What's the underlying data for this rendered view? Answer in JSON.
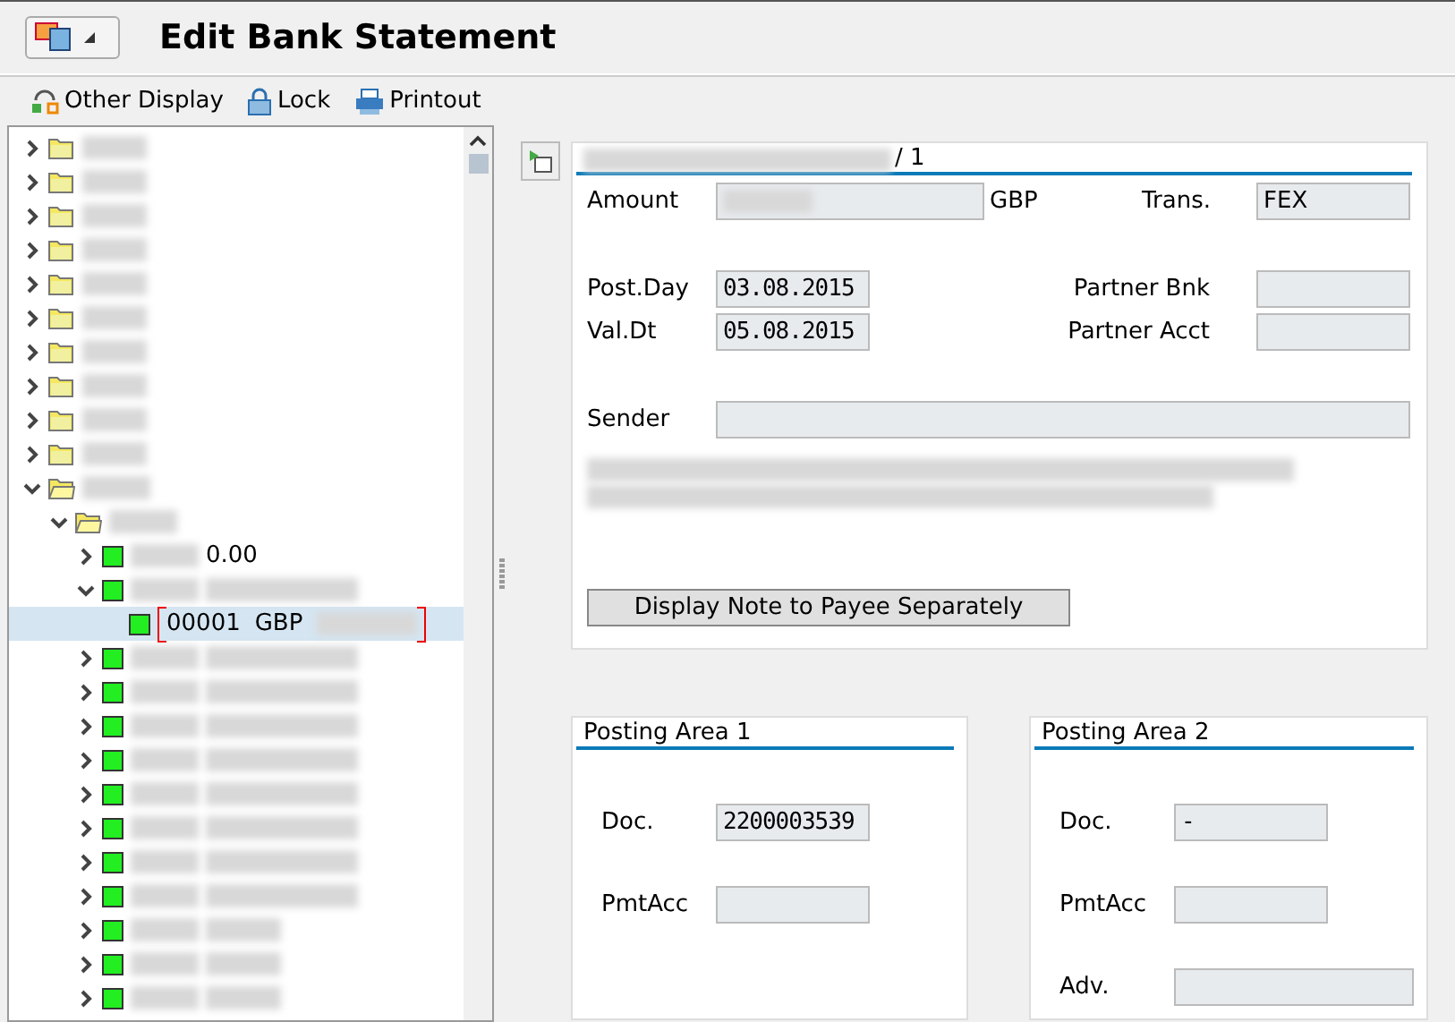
{
  "window": {
    "title": "Edit Bank Statement"
  },
  "toolbar": [
    {
      "kind": "display",
      "label": "Other Display"
    },
    {
      "kind": "lock",
      "label": "Lock"
    },
    {
      "kind": "print",
      "label": "Printout"
    }
  ],
  "tree": {
    "nodes": [
      {
        "kind": "folder",
        "expanded": false,
        "selected": false
      },
      {
        "kind": "folder",
        "expanded": false,
        "selected": false
      },
      {
        "kind": "folder",
        "expanded": false,
        "selected": false
      },
      {
        "kind": "folder",
        "expanded": false,
        "selected": false
      },
      {
        "kind": "folder",
        "expanded": false,
        "selected": false
      },
      {
        "kind": "folder",
        "expanded": false,
        "selected": false
      },
      {
        "kind": "folder",
        "expanded": false,
        "selected": false
      },
      {
        "kind": "folder",
        "expanded": false,
        "selected": false
      },
      {
        "kind": "folder",
        "expanded": false,
        "selected": false
      },
      {
        "kind": "folder",
        "expanded": false,
        "selected": false
      },
      {
        "kind": "folder",
        "expanded": true,
        "selected": false,
        "children": [
          {
            "kind": "folder",
            "expanded": true,
            "selected": false,
            "children": [
              {
                "kind": "item",
                "expanded": false,
                "selected": false,
                "amount": "0.00"
              },
              {
                "kind": "item",
                "expanded": true,
                "selected": false,
                "children": [
                  {
                    "kind": "item",
                    "selected": true,
                    "id": "00001",
                    "currency": "GBP"
                  }
                ]
              },
              {
                "kind": "item",
                "expanded": false,
                "selected": false
              },
              {
                "kind": "item",
                "expanded": false,
                "selected": false
              },
              {
                "kind": "item",
                "expanded": false,
                "selected": false
              },
              {
                "kind": "item",
                "expanded": false,
                "selected": false
              },
              {
                "kind": "item",
                "expanded": false,
                "selected": false
              },
              {
                "kind": "item",
                "expanded": false,
                "selected": false
              },
              {
                "kind": "item",
                "expanded": false,
                "selected": false
              },
              {
                "kind": "item",
                "expanded": false,
                "selected": false
              },
              {
                "kind": "item",
                "expanded": false,
                "selected": false
              },
              {
                "kind": "item",
                "expanded": false,
                "selected": false
              },
              {
                "kind": "item",
                "expanded": false,
                "selected": false
              }
            ]
          }
        ]
      }
    ]
  },
  "header": {
    "title_suffix": "/ 1",
    "amount": {
      "label": "Amount",
      "currency": "GBP"
    },
    "trans": {
      "label": "Trans.",
      "value": "FEX"
    },
    "post_day": {
      "label": "Post.Day",
      "value": "03.08.2015"
    },
    "val_dt": {
      "label": "Val.Dt",
      "value": "05.08.2015"
    },
    "partner_bnk": {
      "label": "Partner Bnk"
    },
    "partner_acct": {
      "label": "Partner Acct"
    },
    "sender": {
      "label": "Sender"
    },
    "note_button": "Display Note to Payee Separately"
  },
  "posting_areas": [
    {
      "title": "Posting Area 1",
      "fields": [
        {
          "label": "Doc.",
          "value": "2200003539",
          "wide": false
        },
        {
          "label": "PmtAcc",
          "wide": false
        }
      ]
    },
    {
      "title": "Posting Area 2",
      "fields": [
        {
          "label": "Doc.",
          "value": "-",
          "wide": false
        },
        {
          "label": "PmtAcc",
          "wide": false
        },
        {
          "label": "Adv.",
          "wide": true
        }
      ]
    }
  ]
}
